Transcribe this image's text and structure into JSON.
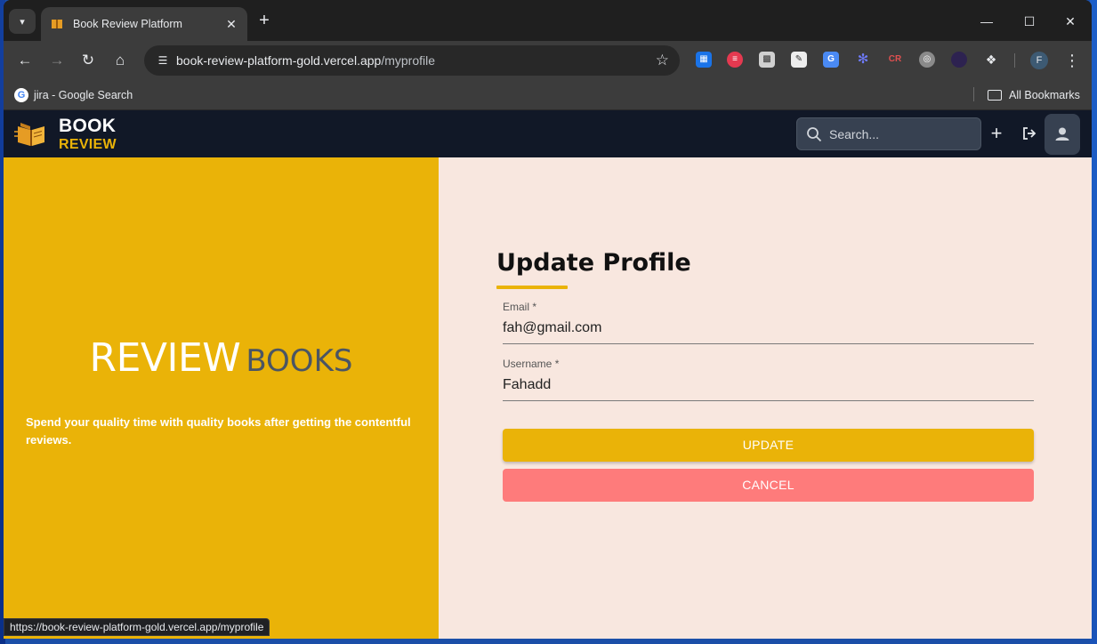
{
  "browser": {
    "tab_title": "Book Review Platform",
    "url_host": "book-review-platform-gold.vercel.app",
    "url_path": "/myprofile",
    "bookmark_item": "jira - Google Search",
    "all_bookmarks": "All Bookmarks",
    "profile_initial": "F",
    "status_url": "https://book-review-platform-gold.vercel.app/myprofile"
  },
  "app": {
    "logo_line1": "BOOK",
    "logo_line2": "REVIEW",
    "search_placeholder": "Search...",
    "accent_color": "#eab308",
    "navbar_color": "#111827"
  },
  "hero": {
    "title_main": "REVIEW",
    "title_secondary": "BOOKS",
    "description": "Spend your quality time with quality books after getting the contentful reviews."
  },
  "form": {
    "title": "Update Profile",
    "email_label": "Email *",
    "email_value": "fah@gmail.com",
    "username_label": "Username *",
    "username_value": "Fahadd",
    "update_label": "UPDATE",
    "cancel_label": "CANCEL"
  }
}
